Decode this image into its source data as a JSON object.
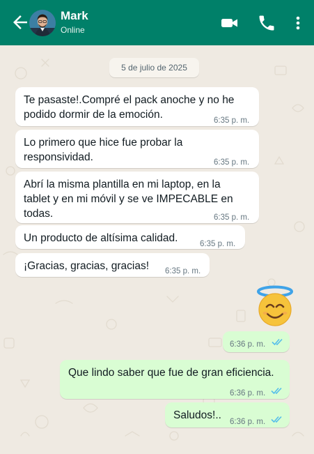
{
  "header": {
    "contact_name": "Mark",
    "status": "Online",
    "icons": [
      "back-arrow-icon",
      "avatar-photo",
      "video-call-icon",
      "phone-icon",
      "more-vertical-icon"
    ]
  },
  "chat": {
    "date": "5 de julio de 2025",
    "incoming": [
      {
        "lines": [
          "Te pasaste!.Compré el pack anoche y no he",
          "podido dormir de la emoción."
        ],
        "time": "6:35 p. m."
      },
      {
        "lines": [
          "Lo primero que hice fue probar la",
          "responsividad."
        ],
        "time": "6:35 p. m."
      },
      {
        "lines": [
          "Abrí la misma plantilla en mi laptop, en la",
          "tablet y en mi móvil y se ve IMPECABLE en",
          "todas."
        ],
        "time": "6:35 p. m."
      },
      {
        "lines": [
          "Un producto de altísima calidad."
        ],
        "time": "6:35 p. m."
      },
      {
        "lines": [
          "¡Gracias, gracias, gracias!"
        ],
        "time": "6:35 p. m."
      }
    ],
    "outgoing": [
      {
        "emoji": "smiling-face-with-halo",
        "time": "6:36 p. m.",
        "status": "read"
      },
      {
        "text": "Que lindo saber que fue de gran eficiencia.",
        "time": "6:36 p. m.",
        "status": "read"
      },
      {
        "text": "Saludos!..",
        "time": "6:36 p. m.",
        "status": "read"
      }
    ]
  },
  "colors": {
    "header": "#008069",
    "chat_background": "#efeae2",
    "incoming_bubble": "#ffffff",
    "outgoing_bubble": "#d9fdd3",
    "read_ticks": "#53bdeb"
  }
}
